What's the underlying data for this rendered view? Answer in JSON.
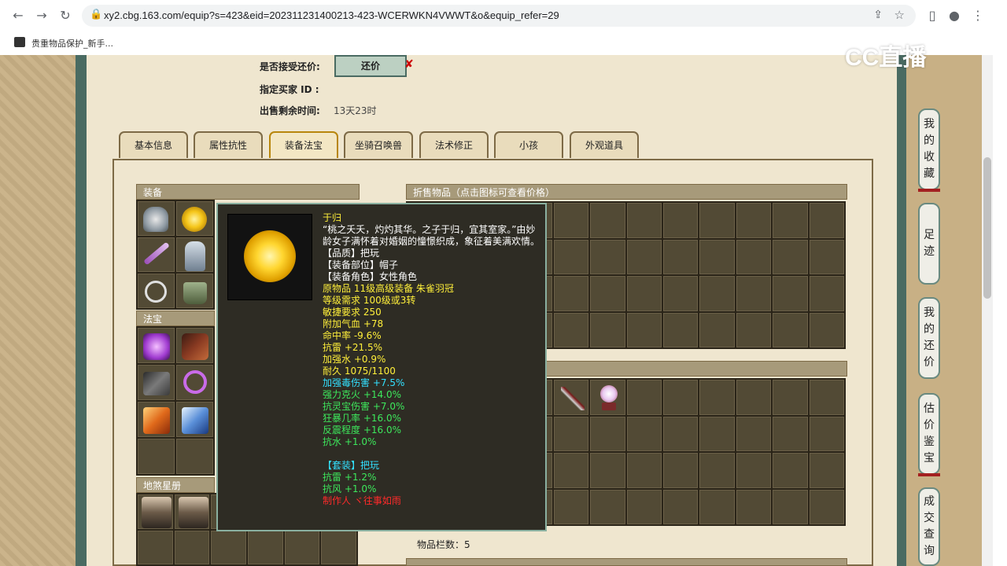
{
  "browser": {
    "url": "xy2.cbg.163.com/equip?s=423&eid=202311231400213-423-WCERWKN4VWWT&o&equip_refer=29",
    "bookmark": "贵重物品保护_新手..."
  },
  "info": {
    "counter_offer_label": "是否接受还价:",
    "counter_offer_button": "还价",
    "buyer_id_label": "指定买家 ID :",
    "remaining_label": "出售剩余时间:",
    "remaining_value": "13天23时"
  },
  "tabs": [
    "基本信息",
    "属性抗性",
    "装备法宝",
    "坐骑召唤兽",
    "法术修正",
    "小孩",
    "外观道具"
  ],
  "sections": {
    "equipment": "装备",
    "treasure": "法宝",
    "constellation": "地煞星册",
    "broken_items": "折售物品（点击图标可查看价格）"
  },
  "tooltip": {
    "lines": [
      {
        "text": "于归",
        "color": "yellow"
      },
      {
        "text": "“桃之夭夭，灼灼其华。之子于归，宜其室家。”由妙龄女子满怀着对婚姻的憧憬织成，象征着美满欢情。",
        "color": "white"
      },
      {
        "text": "【品质】把玩",
        "color": "white"
      },
      {
        "text": "【装备部位】帽子",
        "color": "white"
      },
      {
        "text": "【装备角色】女性角色",
        "color": "white"
      },
      {
        "text": "原物品 11级高级装备 朱雀羽冠",
        "color": "yellow"
      },
      {
        "text": "等级需求 100级或3转",
        "color": "yellow"
      },
      {
        "text": "敏捷要求 250",
        "color": "yellow"
      },
      {
        "text": "附加气血 +78",
        "color": "yellow"
      },
      {
        "text": "命中率 -9.6%",
        "color": "yellow"
      },
      {
        "text": "抗雷 +21.5%",
        "color": "yellow"
      },
      {
        "text": "加强水 +0.9%",
        "color": "yellow"
      },
      {
        "text": "耐久 1075/1100",
        "color": "yellow"
      },
      {
        "text": "加强毒伤害 +7.5%",
        "color": "cyan"
      },
      {
        "text": "强力克火 +14.0%",
        "color": "green"
      },
      {
        "text": "抗灵宝伤害 +7.0%",
        "color": "green"
      },
      {
        "text": "狂暴几率 +16.0%",
        "color": "green"
      },
      {
        "text": "反震程度 +16.0%",
        "color": "green"
      },
      {
        "text": "抗水 +1.0%",
        "color": "green"
      },
      {
        "text": " ",
        "color": "white"
      },
      {
        "text": "【套装】把玩",
        "color": "cyan"
      },
      {
        "text": "抗雷 +1.2%",
        "color": "green"
      },
      {
        "text": "抗风 +1.0%",
        "color": "green"
      },
      {
        "text": "制作人 ヾ往事如雨",
        "color": "red"
      }
    ]
  },
  "items_count_label": "物品栏数：5",
  "right_buttons": [
    "我的收藏",
    "足迹",
    "我的还价",
    "估价鉴宝",
    "成交查询"
  ],
  "watermark": "CC直播",
  "colors": {
    "yellow": "#ffef3a",
    "white": "#ffffff",
    "cyan": "#33e0ff",
    "green": "#3de85c",
    "red": "#ff2a2a"
  }
}
